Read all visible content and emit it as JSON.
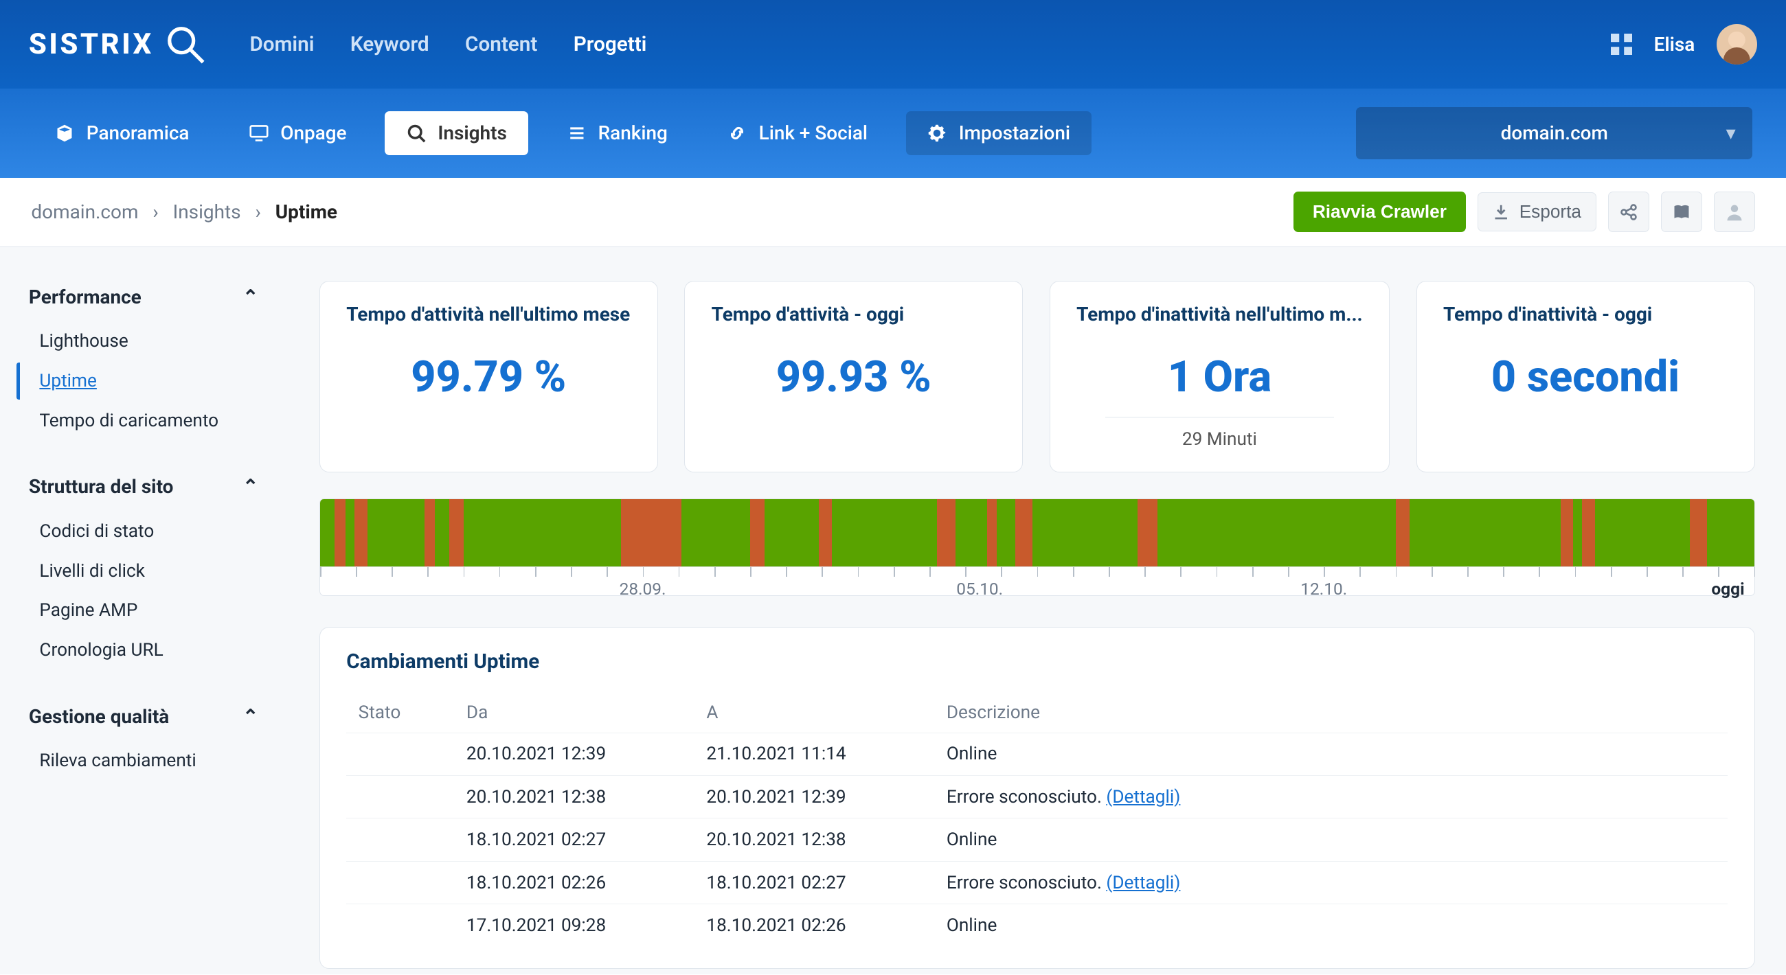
{
  "brand": "SISTRIX",
  "top_nav": {
    "items": [
      "Domini",
      "Keyword",
      "Content",
      "Progetti"
    ],
    "active_index": 3
  },
  "user": {
    "name": "Elisa"
  },
  "sub_nav": {
    "items": [
      {
        "label": "Panoramica",
        "icon": "cube-icon"
      },
      {
        "label": "Onpage",
        "icon": "monitor-icon"
      },
      {
        "label": "Insights",
        "icon": "search-icon"
      },
      {
        "label": "Ranking",
        "icon": "list-icon"
      },
      {
        "label": "Link + Social",
        "icon": "link-icon"
      },
      {
        "label": "Impostazioni",
        "icon": "gear-icon"
      }
    ],
    "active_index": 2,
    "domain_selector": "domain.com"
  },
  "breadcrumb": {
    "root": "domain.com",
    "section": "Insights",
    "current": "Uptime"
  },
  "actions": {
    "restart_crawler": "Riavvia Crawler",
    "export": "Esporta"
  },
  "sidebar": {
    "sections": [
      {
        "title": "Performance",
        "items": [
          "Lighthouse",
          "Uptime",
          "Tempo di caricamento"
        ],
        "active_index": 1
      },
      {
        "title": "Struttura del sito",
        "items": [
          "Codici di stato",
          "Livelli di click",
          "Pagine AMP",
          "Cronologia URL"
        ],
        "active_index": -1
      },
      {
        "title": "Gestione qualità",
        "items": [
          "Rileva cambiamenti"
        ],
        "active_index": -1
      }
    ]
  },
  "cards": [
    {
      "title": "Tempo d'attività nell'ultimo mese",
      "value": "99.79 %"
    },
    {
      "title": "Tempo d'attività - oggi",
      "value": "99.93 %"
    },
    {
      "title": "Tempo d'inattività nell'ultimo m...",
      "value": "1 Ora",
      "sub": "29 Minuti"
    },
    {
      "title": "Tempo d'inattività - oggi",
      "value": "0 secondi"
    }
  ],
  "chart_data": {
    "type": "bar",
    "description": "Uptime timeline last ~month; green = online, orange segments = downtime",
    "axis_labels": [
      "28.09.",
      "05.10.",
      "12.10.",
      "oggi"
    ],
    "axis_label_positions_pct": [
      22.5,
      46,
      70,
      99
    ],
    "downtime_segments_pct": [
      {
        "start": 1.0,
        "width": 0.8
      },
      {
        "start": 2.4,
        "width": 0.9
      },
      {
        "start": 7.3,
        "width": 0.7
      },
      {
        "start": 9.0,
        "width": 1.0
      },
      {
        "start": 21.0,
        "width": 4.2
      },
      {
        "start": 30.0,
        "width": 1.0
      },
      {
        "start": 34.8,
        "width": 0.9
      },
      {
        "start": 43.0,
        "width": 1.3
      },
      {
        "start": 46.5,
        "width": 0.7
      },
      {
        "start": 48.5,
        "width": 1.2
      },
      {
        "start": 57.0,
        "width": 1.4
      },
      {
        "start": 75.0,
        "width": 1.0
      },
      {
        "start": 86.5,
        "width": 0.9
      },
      {
        "start": 88.0,
        "width": 0.9
      },
      {
        "start": 95.5,
        "width": 1.2
      }
    ],
    "colors": {
      "up": "#59a300",
      "down": "#c85a2c"
    }
  },
  "table": {
    "title": "Cambiamenti Uptime",
    "columns": [
      "Stato",
      "Da",
      "A",
      "Descrizione"
    ],
    "rows": [
      {
        "from": "20.10.2021 12:39",
        "to": "21.10.2021 11:14",
        "desc": "Online"
      },
      {
        "from": "20.10.2021 12:38",
        "to": "20.10.2021 12:39",
        "desc": "Errore sconosciuto.",
        "detail": "(Dettagli)"
      },
      {
        "from": "18.10.2021 02:27",
        "to": "20.10.2021 12:38",
        "desc": "Online"
      },
      {
        "from": "18.10.2021 02:26",
        "to": "18.10.2021 02:27",
        "desc": "Errore sconosciuto.",
        "detail": "(Dettagli)"
      },
      {
        "from": "17.10.2021 09:28",
        "to": "18.10.2021 02:26",
        "desc": "Online"
      }
    ]
  }
}
